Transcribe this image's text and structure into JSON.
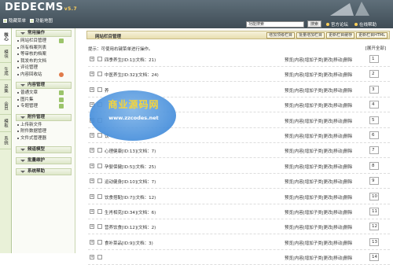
{
  "header": {
    "logo": "DEDECMS",
    "version": "v5.7",
    "buttons": [
      "隐藏菜单",
      "功能地图"
    ],
    "search_value": "功能搜索",
    "search_button": "搜索",
    "links": [
      "官方论坛",
      "在线帮助"
    ]
  },
  "vtabs": [
    "核心",
    "模块",
    "生成",
    "采集",
    "会员",
    "模板",
    "系统"
  ],
  "sidebar": {
    "sections": [
      {
        "title": "常用操作",
        "items": [
          "网站栏目管理",
          "所有档案列表",
          "等审核的档案",
          "我发布的文档",
          "评论管理",
          "内容回收站"
        ]
      },
      {
        "title": "内容管理",
        "items": [
          "普通文章",
          "图片集",
          "专题管理"
        ]
      },
      {
        "title": "附件管理",
        "items": [
          "上传新文件",
          "附件数据管理",
          "文件式管理器"
        ]
      },
      {
        "title": "频道模型",
        "items": []
      },
      {
        "title": "批量维护",
        "items": []
      },
      {
        "title": "系统帮助",
        "items": []
      }
    ]
  },
  "main": {
    "title": "网站栏目管理",
    "buttons": [
      "增加顶级栏目",
      "批量增加栏目",
      "更新栏目缓存",
      "更新栏目HTML"
    ],
    "tip": "提示：可使用右键菜单进行操作。",
    "expand_all": "[展开全部]",
    "ops": "预览|内容|增加子类|更改|移动|删除",
    "rows": [
      {
        "name": "四季养生[ID:1](文档：21)",
        "order": "1"
      },
      {
        "name": "中医养生[ID:32](文档：24)",
        "order": "2"
      },
      {
        "name": "养",
        "order": "3"
      },
      {
        "name": "",
        "order": "4"
      },
      {
        "name": "",
        "order": "5"
      },
      {
        "name": "饮",
        "order": "6"
      },
      {
        "name": "心理健康[ID:13](文档：7)",
        "order": "7"
      },
      {
        "name": "孕婴保健[ID:5](文档：25)",
        "order": "8"
      },
      {
        "name": "运动健身[ID:10](文档：7)",
        "order": "9"
      },
      {
        "name": "饮食搭配[ID:7](文档：12)",
        "order": "10"
      },
      {
        "name": "生肖相克[ID:34](文档：6)",
        "order": "11"
      },
      {
        "name": "营养饮食[ID:12](文档：2)",
        "order": "12"
      },
      {
        "name": "食补菜品[ID:9](文档：3)",
        "order": "13"
      },
      {
        "name": "",
        "order": "14"
      }
    ]
  },
  "watermark": {
    "line1": "商业源码网",
    "line2": "www.zzcodes.net"
  }
}
